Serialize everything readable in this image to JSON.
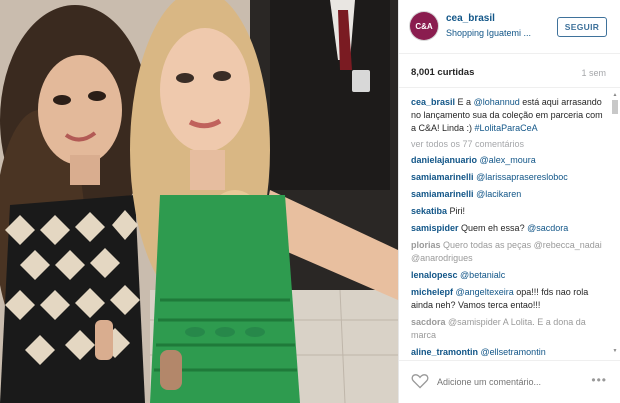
{
  "header": {
    "avatar_text": "C&A",
    "username": "cea_brasil",
    "location": "Shopping Iguatemi ...",
    "follow_label": "SEGUIR"
  },
  "stats": {
    "likes": "8,001 curtidas",
    "time": "1 sem"
  },
  "caption": {
    "user": "cea_brasil",
    "text_before": " E a ",
    "mention": "@lohannud",
    "text_after": " está aqui arrasando no lançamento sua da coleção em parceria com a C&A! Linda :) ",
    "hashtag": "#LolitaParaCeA"
  },
  "view_all": "ver todos os 77 comentários",
  "comments": [
    {
      "user": "danielajanuario",
      "text": "",
      "mention": "@alex_moura"
    },
    {
      "user": "samiamarinelli",
      "text": "",
      "mention": "@larissapraseresloboc"
    },
    {
      "user": "samiamarinelli",
      "text": "",
      "mention": "@lacikaren"
    },
    {
      "user": "sekatiba",
      "text": " Piri!",
      "mention": ""
    },
    {
      "user": "samispider",
      "text": " Quem eh essa? ",
      "mention": "@sacdora"
    },
    {
      "user": "plorias",
      "text": " Quero todas as peças ",
      "mention": "@rebecca_nadai @anarodrigues",
      "faded": true
    },
    {
      "user": "lenalopesc",
      "text": "",
      "mention": "@betanialc"
    },
    {
      "user": "michelepf",
      "text": " opa!!! fds nao rola ainda neh? Vamos terca entao!!!",
      "mention": "@angeltexeira"
    },
    {
      "user": "sacdora",
      "text": " A Lolita. E a dona da marca",
      "mention": "@samispider",
      "faded": true
    },
    {
      "user": "aline_tramontin",
      "text": "",
      "mention": "@ellsetramontin"
    }
  ],
  "footer": {
    "add_comment_placeholder": "Adicione um comentário...",
    "more_label": "•••"
  },
  "colors": {
    "link": "#125688",
    "follow_border": "#3f729b",
    "muted": "#a5a7aa",
    "dress_green": "#2e9b4f"
  },
  "icons": [
    "heart-icon",
    "more-options-icon",
    "scroll-up-arrow",
    "scroll-down-arrow"
  ]
}
